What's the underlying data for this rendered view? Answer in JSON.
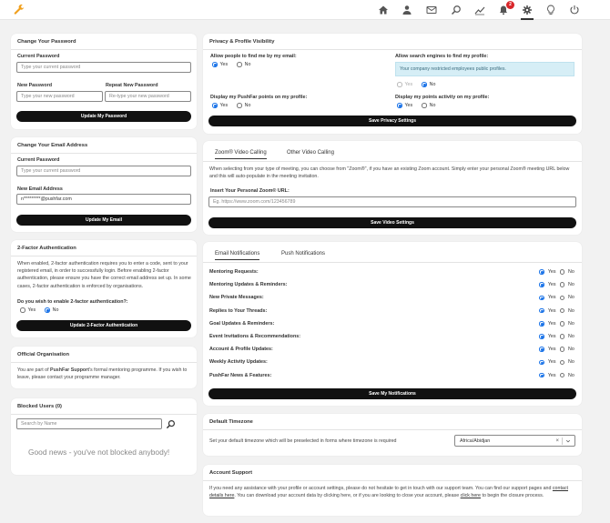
{
  "nav": {
    "notifications_count": "2",
    "icons": [
      "home-icon",
      "user-icon",
      "mail-icon",
      "search-icon",
      "chart-icon",
      "bell-icon",
      "settings-icon",
      "lightbulb-icon",
      "power-icon"
    ]
  },
  "change_password": {
    "title": "Change Your Password",
    "current_label": "Current Password",
    "current_placeholder": "Type your current password",
    "new_label": "New Password",
    "new_placeholder": "Type your new password",
    "repeat_label": "Repeat New Password",
    "repeat_placeholder": "Re-type your new password",
    "button": "Update My Password"
  },
  "change_email": {
    "title": "Change Your Email Address",
    "current_label": "Current Password",
    "current_placeholder": "Type your current password",
    "new_label": "New Email Address",
    "new_value": "n*********@pushfar.com",
    "button": "Update My Email"
  },
  "two_factor": {
    "title": "2-Factor Authentication",
    "description": "When enabled, 2-factor authentication requires you to enter a code, sent to your registered email, in order to successfully login. Before enabling 2-factor authentication, please ensure you have the correct email address set up. In some cases, 2-factor authentication is enforced by organisations.",
    "question": "Do you wish to enable 2-factor authentication?:",
    "yes": "Yes",
    "no": "No",
    "button": "Update 2-Factor Authentication"
  },
  "official_org": {
    "title": "Official Organisation",
    "text_before": "You are part of ",
    "org_name": "PushFar Support",
    "text_after": "'s formal mentoring programme. If you wish to leave, please contact your programme manager."
  },
  "blocked_users": {
    "title": "Blocked Users (0)",
    "search_placeholder": "Search by Name",
    "empty_message": "Good news - you've not blocked anybody!"
  },
  "privacy": {
    "title": "Privacy & Profile Visibility",
    "find_by_email_label": "Allow people to find me by my email:",
    "search_engines_label": "Allow search engines to find my profile:",
    "restricted_notice": "Your company restricted employees public profiles.",
    "display_points_label": "Display my PushFar points on my profile:",
    "display_activity_label": "Display my points activity on my profile:",
    "yes": "Yes",
    "no": "No",
    "button": "Save Privacy Settings"
  },
  "video": {
    "tab_zoom": "Zoom® Video Calling",
    "tab_other": "Other Video Calling",
    "description_before": "When selecting from your type of meeting, you can choose from \"Zoom®\", if you have an existing Zoom account. Simply enter your personal Zoom® meeting URL below and this will auto-populate in the meeting invitation.",
    "url_label": "Insert Your Personal Zoom® URL:",
    "url_placeholder": "Eg. https://www.zoom.com/123456789",
    "button": "Save Video Settings"
  },
  "notifications": {
    "tab_email": "Email Notifications",
    "tab_push": "Push Notifications",
    "yes": "Yes",
    "no": "No",
    "items": [
      "Mentoring Requests:",
      "Mentoring Updates & Reminders:",
      "New Private Messages:",
      "Replies to Your Threads:",
      "Goal Updates & Reminders:",
      "Event Invitations & Recommendations:",
      "Account & Profile Updates:",
      "Weekly Activity Updates:",
      "PushFar News & Features:"
    ],
    "button": "Save My Notifications"
  },
  "timezone": {
    "title": "Default Timezone",
    "description": "Set your default timezone which will be preselected in forms where timezone is required",
    "selected": "Africa/Abidjan"
  },
  "support": {
    "title": "Account Support",
    "text_1": "If you need any assistance with your profile or account settings, please do not hesitate to get in touch with our support team. You can find our support pages and ",
    "link_contact": "contact details here",
    "text_2": ". You can download your account data by clicking here, or if you are looking to close your account, please ",
    "link_close": "click here",
    "text_3": " to begin the closure process."
  },
  "colors": {
    "accent": "#1a73e8",
    "button": "#111111",
    "logo": "#f0a01e",
    "badge": "#d9262a",
    "notice_bg": "#d6eef6"
  }
}
